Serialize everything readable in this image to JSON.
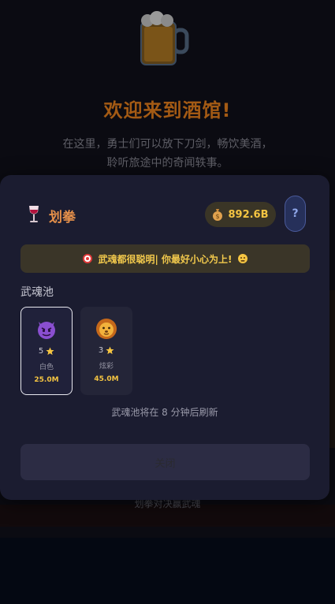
{
  "background": {
    "title": "欢迎来到酒馆!",
    "subtitle_line1": "在这里，勇士们可以放下刀剑，畅饮美酒，",
    "subtitle_line2": "聆听旅途中的奇闻轶事。",
    "footer_text": "划拳对决赢武魂"
  },
  "modal": {
    "title": "划拳",
    "coin_value": "892.6B",
    "help_label": "?",
    "notice": "武魂都很聪明| 你最好小心为上!",
    "section_title": "武魂池",
    "cards": [
      {
        "icon": "devil-face-icon",
        "level": "5",
        "grade": "白色",
        "price": "25.0M",
        "selected": true
      },
      {
        "icon": "lion-face-icon",
        "level": "3",
        "grade": "炫彩",
        "price": "45.0M",
        "selected": false
      }
    ],
    "refresh_text": "武魂池将在 8 分钟后刷新",
    "close_label": "关闭"
  },
  "colors": {
    "accent_orange": "#e6904a",
    "gold": "#f5c542",
    "modal_bg": "#1b1c30"
  }
}
